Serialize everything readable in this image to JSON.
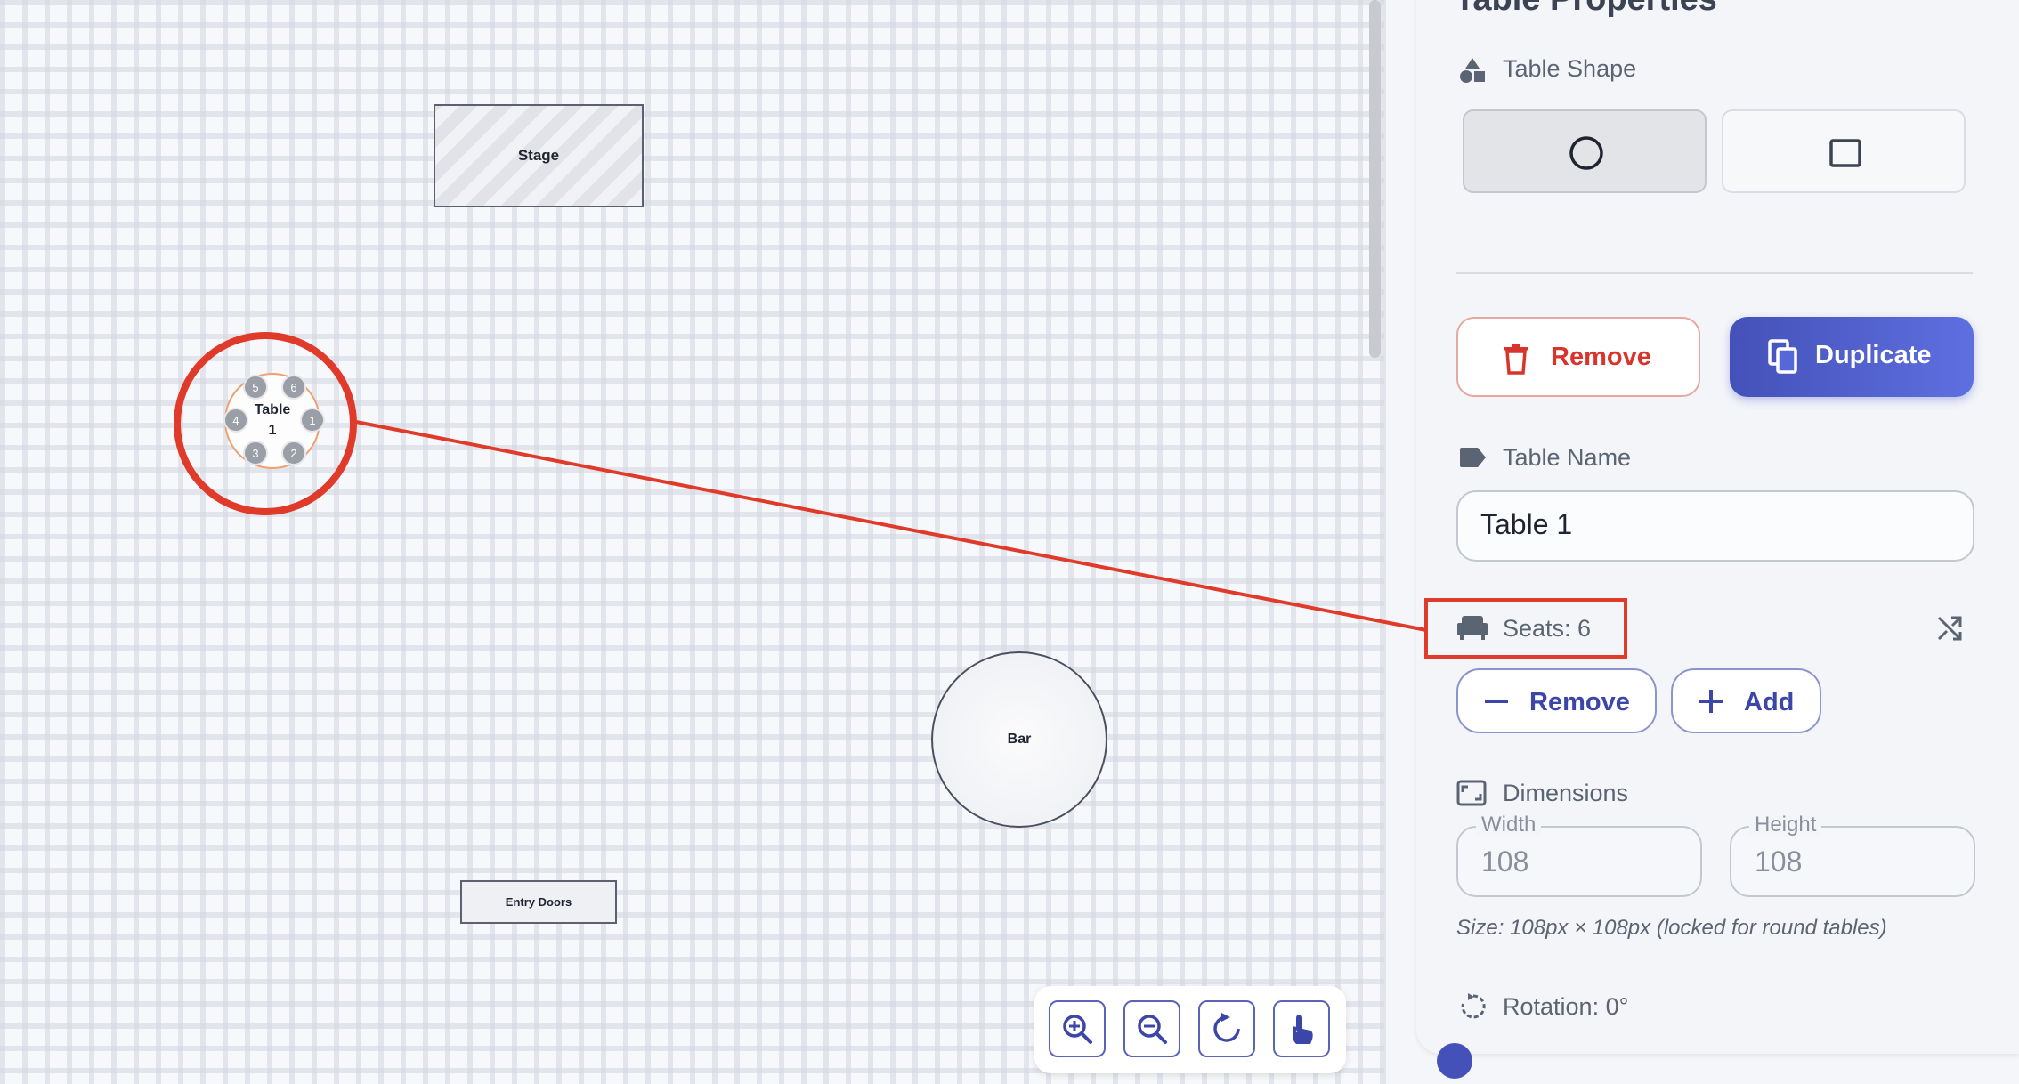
{
  "canvas": {
    "stage_label": "Stage",
    "entry_label": "Entry Doors",
    "bar_label": "Bar",
    "table": {
      "label_line1": "Table",
      "label_line2": "1",
      "seats": [
        "1",
        "2",
        "3",
        "4",
        "5",
        "6"
      ]
    },
    "zoom_buttons": [
      "zoom-in-icon",
      "zoom-out-icon",
      "reset-rotate-icon",
      "pan-hand-icon"
    ]
  },
  "panel": {
    "title": "Table Properties",
    "shape_label": "Table Shape",
    "shape_options": [
      "circle",
      "square"
    ],
    "remove_label": "Remove",
    "duplicate_label": "Duplicate",
    "name_label": "Table Name",
    "name_value": "Table 1",
    "seats_label": "Seats: 6",
    "seat_remove_label": "Remove",
    "seat_add_label": "Add",
    "dimensions_label": "Dimensions",
    "width_label": "Width",
    "width_value": "108",
    "height_label": "Height",
    "height_value": "108",
    "size_note": "Size: 108px × 108px (locked for round tables)",
    "rotation_label": "Rotation: 0°"
  },
  "colors": {
    "accent": "#4451b8",
    "danger": "#d9342b",
    "annotation": "#e03a2a"
  }
}
